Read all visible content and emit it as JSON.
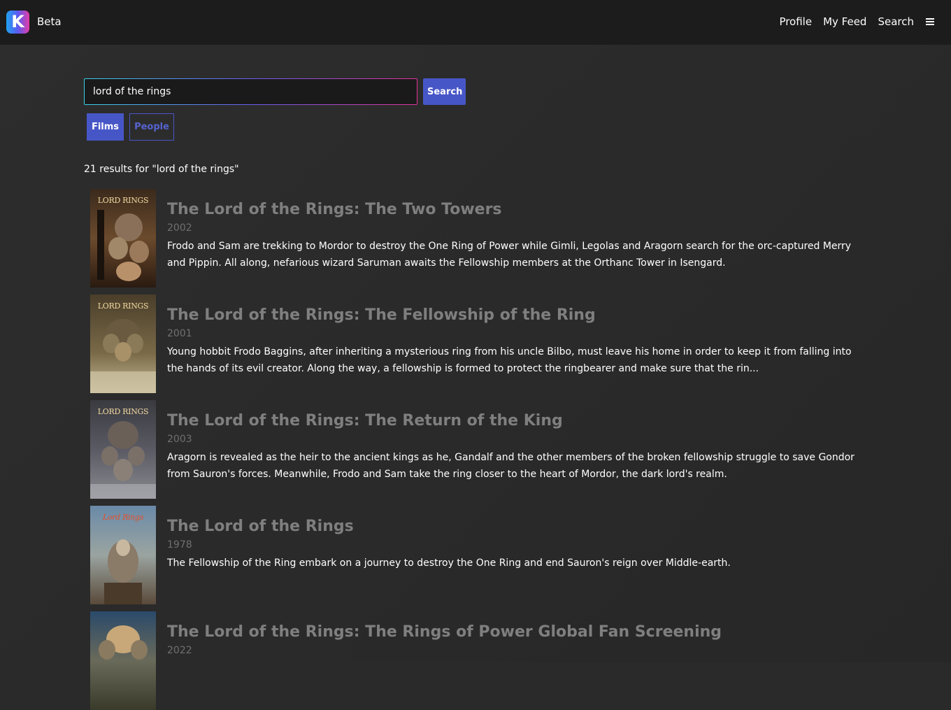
{
  "nav": {
    "brand_letter": "K",
    "brand_label": "Beta",
    "links": [
      "Profile",
      "My Feed",
      "Search"
    ]
  },
  "search": {
    "query": "lord of the rings",
    "button_label": "Search"
  },
  "tabs": {
    "films": "Films",
    "people": "People"
  },
  "results_summary": "21 results for \"lord of the rings\"",
  "results": [
    {
      "title": "The Lord of the Rings: The Two Towers",
      "year": "2002",
      "description": "Frodo and Sam are trekking to Mordor to destroy the One Ring of Power while Gimli, Legolas and Aragorn search for the orc-captured Merry and Pippin. All along, nefarious wizard Saruman awaits the Fellowship members at the Orthanc Tower in Isengard.",
      "poster_text": "LORD RINGS"
    },
    {
      "title": "The Lord of the Rings: The Fellowship of the Ring",
      "year": "2001",
      "description": "Young hobbit Frodo Baggins, after inheriting a mysterious ring from his uncle Bilbo, must leave his home in order to keep it from falling into the hands of its evil creator. Along the way, a fellowship is formed to protect the ringbearer and make sure that the rin...",
      "poster_text": "LORD RINGS"
    },
    {
      "title": "The Lord of the Rings: The Return of the King",
      "year": "2003",
      "description": "Aragorn is revealed as the heir to the ancient kings as he, Gandalf and the other members of the broken fellowship struggle to save Gondor from Sauron's forces. Meanwhile, Frodo and Sam take the ring closer to the heart of Mordor, the dark lord's realm.",
      "poster_text": "LORD RINGS"
    },
    {
      "title": "The Lord of the Rings",
      "year": "1978",
      "description": "The Fellowship of the Ring embark on a journey to destroy the One Ring and end Sauron's reign over Middle-earth.",
      "poster_text": "Lord Rings"
    },
    {
      "title": "The Lord of the Rings: The Rings of Power Global Fan Screening",
      "year": "2022",
      "description": "",
      "poster_text": ""
    }
  ]
}
